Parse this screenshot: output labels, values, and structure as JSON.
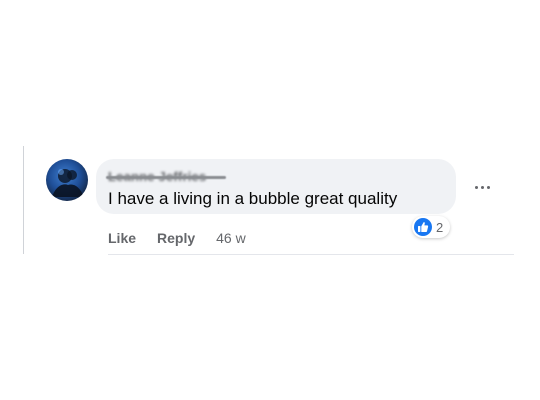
{
  "comment": {
    "author": "Leanne Jeffries",
    "text": "I have a living in a bubble great quality",
    "reaction_icon": "like-icon",
    "reaction_count": "2",
    "timestamp": "46 w",
    "actions": {
      "like_label": "Like",
      "reply_label": "Reply"
    }
  },
  "colors": {
    "bubble_bg": "#f0f2f5",
    "like_blue": "#1877f2",
    "secondary_text": "#65676b"
  }
}
